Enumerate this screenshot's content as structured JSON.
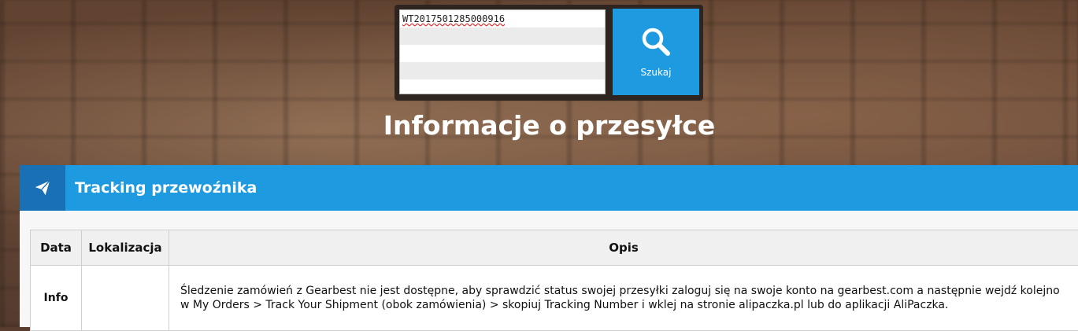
{
  "search": {
    "tracking_value": "WT2017501285000916",
    "button_label": "Szukaj"
  },
  "page": {
    "title": "Informacje o przesyłce"
  },
  "panel": {
    "title": "Tracking przewoźnika",
    "icon": "paper-plane-icon"
  },
  "table": {
    "headers": [
      "Data",
      "Lokalizacja",
      "Opis"
    ],
    "rows": [
      {
        "date": "Info",
        "location": "",
        "description": "Śledzenie zamówień z Gearbest nie jest dostępne, aby sprawdzić status swojej przesyłki zaloguj się na swoje konto na gearbest.com a następnie wejdź kolejno w My Orders > Track Your Shipment (obok zamówienia) > skopiuj Tracking Number i wklej na stronie alipaczka.pl lub do aplikacji AliPaczka."
      }
    ]
  },
  "colors": {
    "accent": "#1e9be0",
    "accent_dark": "#1a70b5"
  }
}
